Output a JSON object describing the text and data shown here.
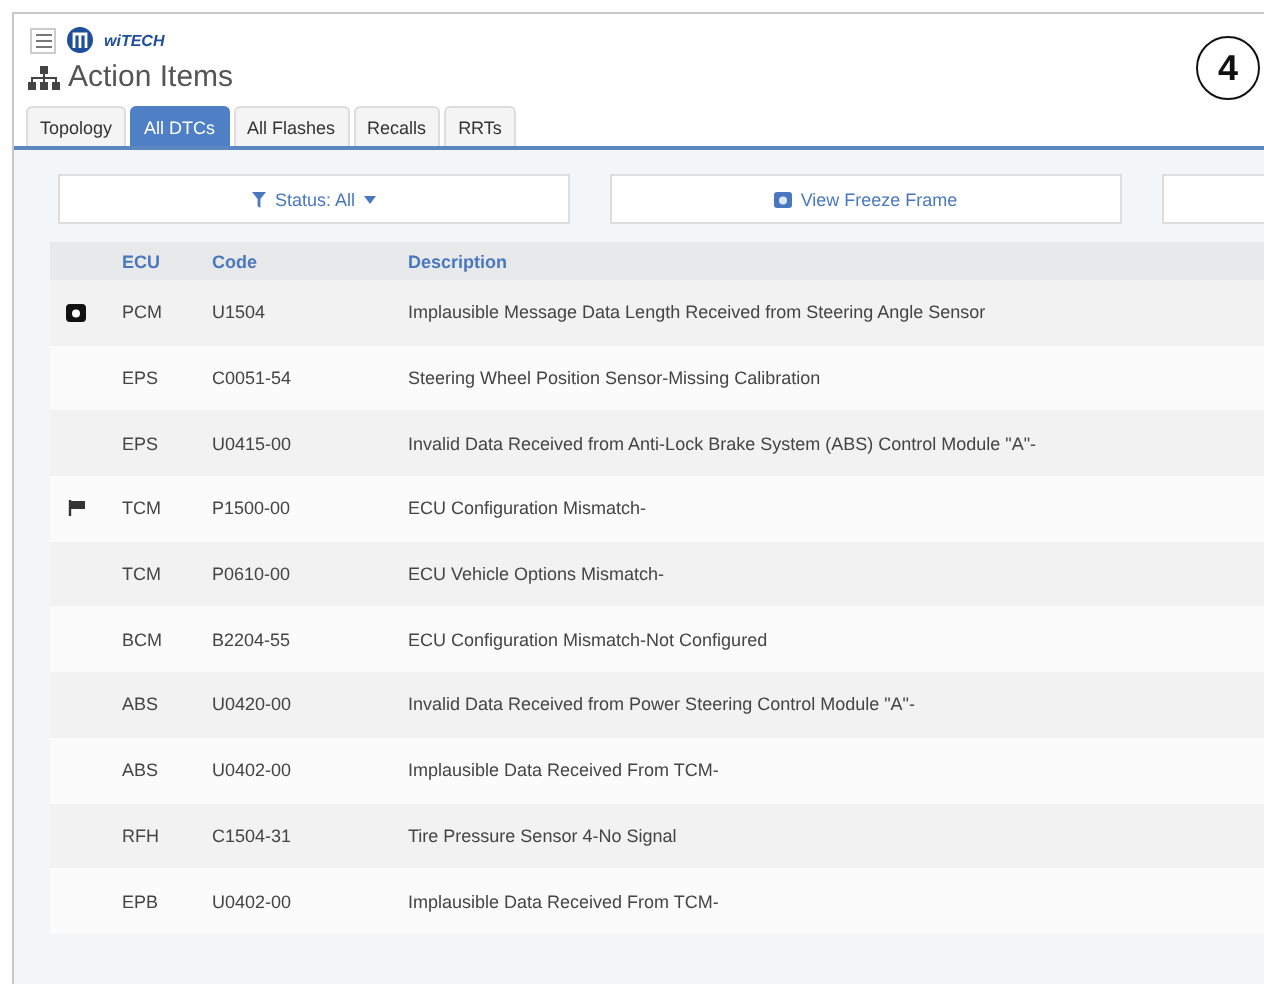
{
  "header": {
    "logo_text": "wiTECH"
  },
  "callout": "4",
  "page_title": "Action Items",
  "tabs": [
    {
      "label": "Topology",
      "selected": false
    },
    {
      "label": "All DTCs",
      "selected": true
    },
    {
      "label": "All Flashes",
      "selected": false
    },
    {
      "label": "Recalls",
      "selected": false
    },
    {
      "label": "RRTs",
      "selected": false
    }
  ],
  "toolbar": {
    "status_filter": "Status: All",
    "freeze_frame_button": "View Freeze Frame"
  },
  "table": {
    "columns": [
      "ECU",
      "Code",
      "Description"
    ],
    "rows": [
      {
        "kind": "camera",
        "ecu": "PCM",
        "code": "U1504",
        "description": "Implausible Message Data Length Received from Steering Angle Sensor"
      },
      {
        "kind": "plain",
        "ecu": "EPS",
        "code": "C0051-54",
        "description": "Steering Wheel Position Sensor-Missing Calibration"
      },
      {
        "kind": "plain",
        "ecu": "EPS",
        "code": "U0415-00",
        "description": "Invalid Data Received from Anti-Lock Brake System (ABS) Control Module \"A\"-"
      },
      {
        "kind": "flagged",
        "ecu": "TCM",
        "code": "P1500-00",
        "description": "ECU Configuration Mismatch-"
      },
      {
        "kind": "plain",
        "ecu": "TCM",
        "code": "P0610-00",
        "description": "ECU Vehicle Options Mismatch-"
      },
      {
        "kind": "plain",
        "ecu": "BCM",
        "code": "B2204-55",
        "description": "ECU Configuration Mismatch-Not Configured"
      },
      {
        "kind": "plain",
        "ecu": "ABS",
        "code": "U0420-00",
        "description": "Invalid Data Received from Power Steering Control Module \"A\"-"
      },
      {
        "kind": "plain",
        "ecu": "ABS",
        "code": "U0402-00",
        "description": "Implausible Data Received From TCM-"
      },
      {
        "kind": "plain",
        "ecu": "RFH",
        "code": "C1504-31",
        "description": "Tire Pressure Sensor 4-No Signal"
      },
      {
        "kind": "plain",
        "ecu": "EPB",
        "code": "U0402-00",
        "description": "Implausible Data Received From TCM-"
      }
    ]
  }
}
